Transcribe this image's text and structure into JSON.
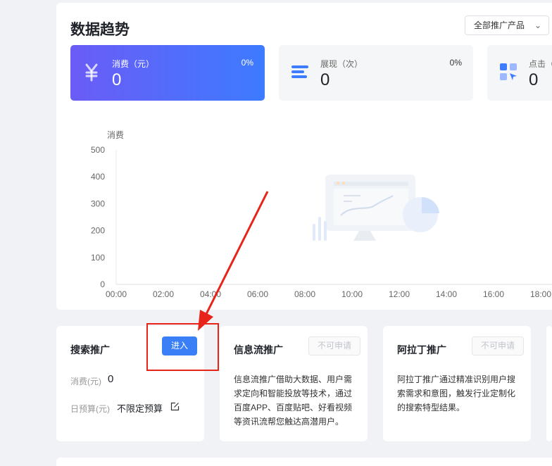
{
  "trend": {
    "title": "数据趋势",
    "product_select": "全部推广产品"
  },
  "metrics": [
    {
      "label": "消费（元）",
      "value": "0",
      "percent": "0%",
      "icon": "yen-icon"
    },
    {
      "label": "展现（次）",
      "value": "0",
      "percent": "0%",
      "icon": "bars-icon"
    },
    {
      "label": "点击（",
      "value": "0",
      "percent": "",
      "icon": "grid-cursor-icon"
    }
  ],
  "chart_data": {
    "type": "line",
    "title": "",
    "ylabel": "消费",
    "xlabel": "",
    "x": [
      "00:00",
      "02:00",
      "04:00",
      "06:00",
      "08:00",
      "10:00",
      "12:00",
      "14:00",
      "16:00",
      "18:00"
    ],
    "y_ticks": [
      "0",
      "100",
      "200",
      "300",
      "400",
      "500"
    ],
    "ylim": [
      0,
      500
    ],
    "series": [],
    "grid": false,
    "empty_state": true
  },
  "cards": {
    "search": {
      "title": "搜索推广",
      "button": "进入",
      "spend_label": "消费(元)",
      "spend_value": "0",
      "budget_label": "日预算(元)",
      "budget_value": "不限定预算"
    },
    "feed": {
      "title": "信息流推广",
      "button": "不可申请",
      "desc": "信息流推广借助大数据、用户需求定向和智能投放等技术，通过百度APP、百度贴吧、好看视频等资讯流帮您触达高潜用户。"
    },
    "aladdin": {
      "title": "阿拉丁推广",
      "button": "不可申请",
      "desc": "阿拉丁推广通过精准识别用户搜索需求和意图，触发行业定制化的搜索特型结果。"
    }
  },
  "colors": {
    "accent": "#3a7ff6",
    "annotation": "#e8231a"
  }
}
